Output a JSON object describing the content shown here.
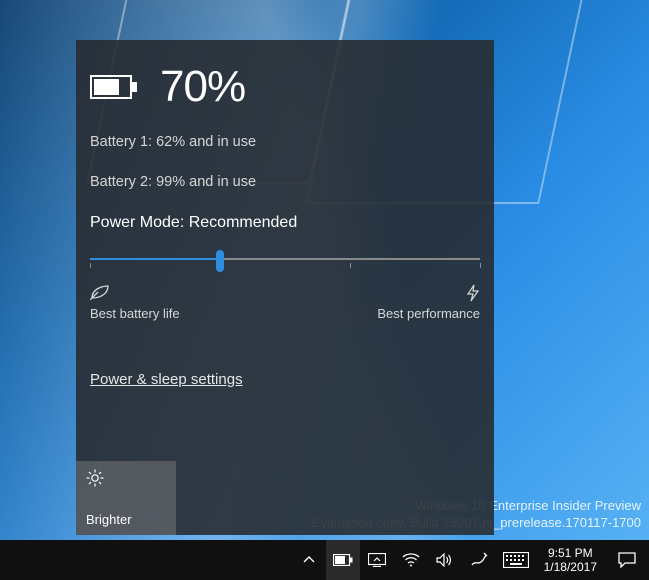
{
  "battery": {
    "overall_percent": "70%",
    "lines": [
      "Battery 1: 62% and in use",
      "Battery 2: 99% and in use"
    ],
    "mode_label": "Power Mode: Recommended",
    "slider": {
      "position_fraction": 0.333
    },
    "endpoints": {
      "left": "Best battery life",
      "right": "Best performance"
    },
    "settings_link": "Power & sleep settings",
    "quick_tile": {
      "label": "Brighter"
    }
  },
  "watermark": {
    "line1": "Windows 10 Enterprise Insider Preview",
    "line2": "Evaluation copy. Build 15007.rs_prerelease.170117-1700"
  },
  "taskbar": {
    "clock_time": "9:51 PM",
    "clock_date": "1/18/2017"
  }
}
